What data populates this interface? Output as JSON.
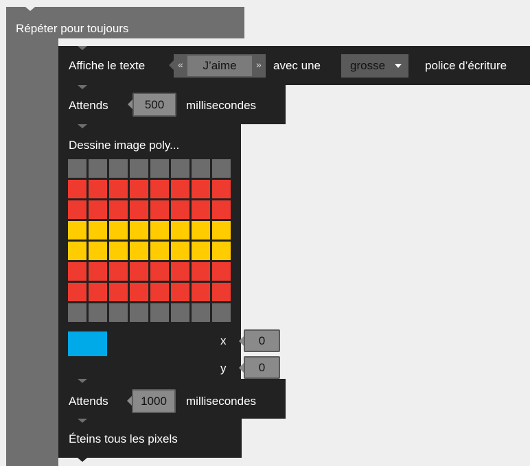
{
  "colors": {
    "gray": "#6c6c6c",
    "red": "#ef3b2f",
    "yellow": "#ffcc00",
    "blue": "#00a9e8"
  },
  "blocks": {
    "repeat_label": "Répéter pour toujours",
    "display_text": {
      "prefix": "Affiche le texte",
      "open_quote": "«",
      "value": "J’aime",
      "close_quote": "»",
      "middle": "avec une",
      "font_size_selected": "grosse",
      "suffix": "police d’écriture"
    },
    "wait_1": {
      "prefix": "Attends",
      "value": "500",
      "suffix": "millisecondes"
    },
    "draw_image": {
      "label": "Dessine image poly...",
      "pixel_rows": [
        [
          "gray",
          "gray",
          "gray",
          "gray",
          "gray",
          "gray",
          "gray",
          "gray"
        ],
        [
          "red",
          "red",
          "red",
          "red",
          "red",
          "red",
          "red",
          "red"
        ],
        [
          "red",
          "red",
          "red",
          "red",
          "red",
          "red",
          "red",
          "red"
        ],
        [
          "yellow",
          "yellow",
          "yellow",
          "yellow",
          "yellow",
          "yellow",
          "yellow",
          "yellow"
        ],
        [
          "yellow",
          "yellow",
          "yellow",
          "yellow",
          "yellow",
          "yellow",
          "yellow",
          "yellow"
        ],
        [
          "red",
          "red",
          "red",
          "red",
          "red",
          "red",
          "red",
          "red"
        ],
        [
          "red",
          "red",
          "red",
          "red",
          "red",
          "red",
          "red",
          "red"
        ],
        [
          "gray",
          "gray",
          "gray",
          "gray",
          "gray",
          "gray",
          "gray",
          "gray"
        ]
      ],
      "selected_color": "blue",
      "x_label": "x",
      "x_value": "0",
      "y_label": "y",
      "y_value": "0"
    },
    "wait_2": {
      "prefix": "Attends",
      "value": "1000",
      "suffix": "millisecondes"
    },
    "clear_label": "Éteins tous les pixels"
  }
}
